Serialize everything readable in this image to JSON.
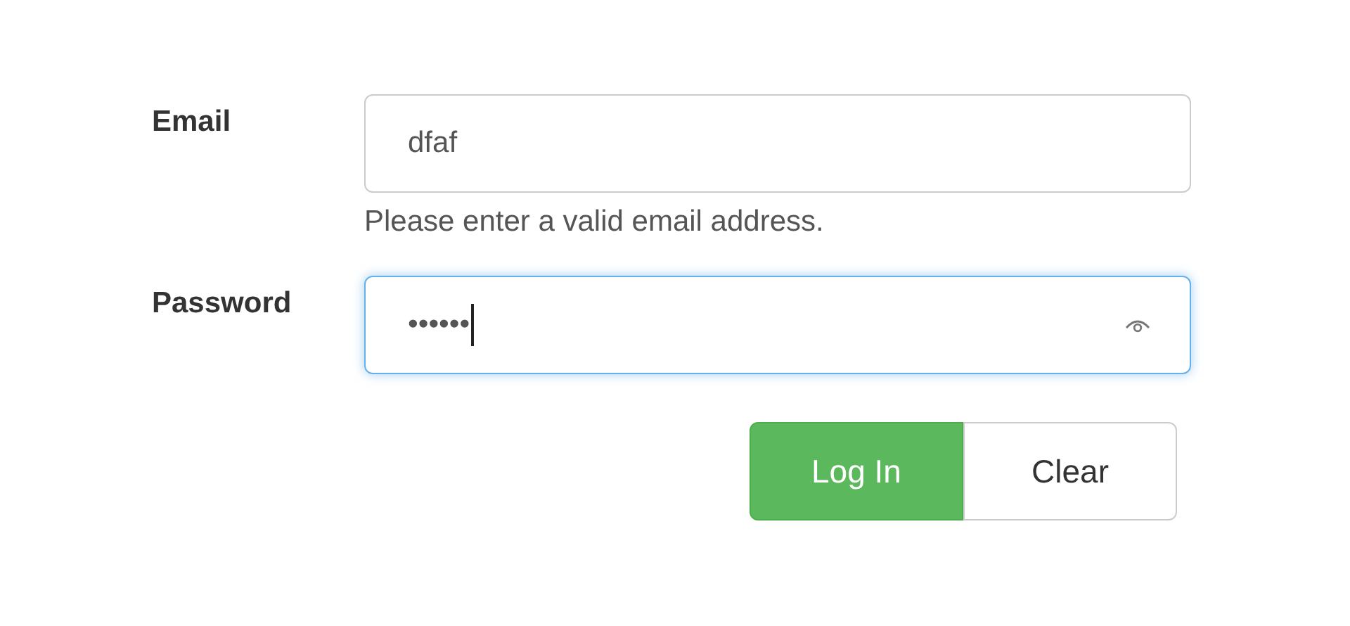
{
  "fields": [
    {
      "label": "Email",
      "value": "dfaf",
      "focused": false,
      "reveal_icon": false,
      "help": "Please enter a valid email address."
    },
    {
      "label": "Password",
      "value": "••••••",
      "focused": true,
      "reveal_icon": true
    }
  ],
  "buttons": [
    {
      "label": "Log In",
      "kind": "primary"
    },
    {
      "label": "Clear",
      "kind": "default"
    }
  ]
}
